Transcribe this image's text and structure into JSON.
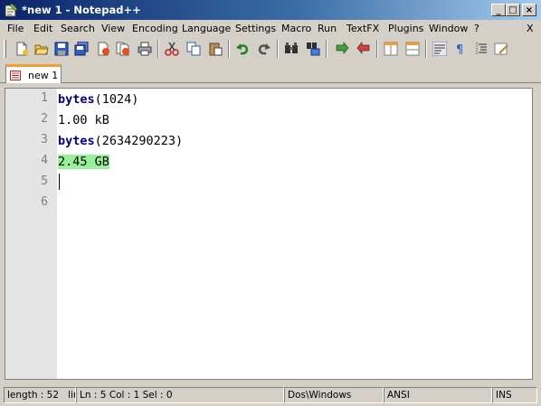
{
  "window": {
    "title": "*new  1 - Notepad++",
    "minimize_label": "_",
    "maximize_label": "□",
    "close_label": "×"
  },
  "menu": {
    "items": [
      "File",
      "Edit",
      "Search",
      "View",
      "Encoding",
      "Language",
      "Settings",
      "Macro",
      "Run",
      "TextFX",
      "Plugins",
      "Window",
      "?"
    ],
    "close_doc_label": "X"
  },
  "toolbar": {
    "buttons": [
      "new-file",
      "open-file",
      "save",
      "save-all",
      "close",
      "close-all",
      "print",
      "cut",
      "copy",
      "paste",
      "undo",
      "redo",
      "find",
      "replace",
      "zoom-in",
      "zoom-out",
      "sync-vertical",
      "sync-horizontal",
      "word-wrap",
      "show-all-chars",
      "indent-guide",
      "user-defined-language"
    ]
  },
  "tabs": [
    {
      "label": "new  1",
      "modified": true
    }
  ],
  "editor": {
    "line_numbers": [
      "1",
      "2",
      "3",
      "4",
      "5",
      "6"
    ],
    "lines": [
      {
        "keyword": "bytes",
        "rest": "(1024)"
      },
      {
        "keyword": "",
        "rest": "1.00 kB"
      },
      {
        "keyword": "bytes",
        "rest": "(2634290223)"
      },
      {
        "keyword": "",
        "rest": "2.45 GB",
        "highlighted": true
      },
      {
        "keyword": "",
        "rest": ""
      },
      {
        "keyword": "",
        "rest": ""
      }
    ],
    "highlight_color": "#98f098",
    "keyword_color": "#000080"
  },
  "status": {
    "length": "length : 52",
    "lines": "line",
    "position": "Ln : 5    Col : 1    Sel : 0",
    "eol": "Dos\\Windows",
    "encoding": "ANSI",
    "mode": "INS"
  }
}
